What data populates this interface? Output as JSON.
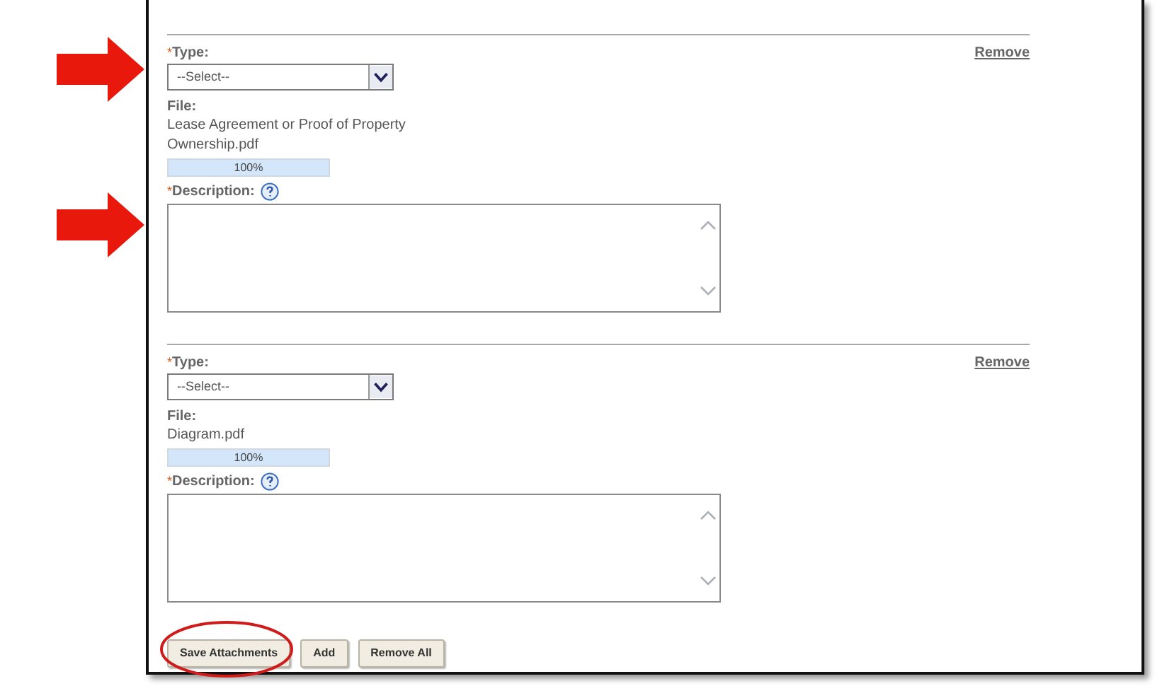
{
  "attachments": [
    {
      "type_label": "Type:",
      "required": true,
      "select": {
        "placeholder": "--Select--"
      },
      "remove": "Remove",
      "file_label": "File:",
      "file_name": "Lease Agreement or Proof of Property Ownership.pdf",
      "progress": {
        "level": 1,
        "reading": "100%"
      },
      "description_label": "Description:",
      "arrows": true
    },
    {
      "type_label": "Type:",
      "required": true,
      "select": {
        "placeholder": "--Select--"
      },
      "remove": "Remove",
      "file_label": "File:",
      "file_name": "Diagram.pdf",
      "progress": {
        "level": 1,
        "reading": "100%"
      },
      "description_label": "Description:",
      "arrows": false
    }
  ],
  "required_mark": "*",
  "buttons": [
    {
      "label": "Save Attachments",
      "highlighted": true
    },
    {
      "label": "Add",
      "highlighted": false
    },
    {
      "label": "Remove All",
      "highlighted": false
    }
  ]
}
